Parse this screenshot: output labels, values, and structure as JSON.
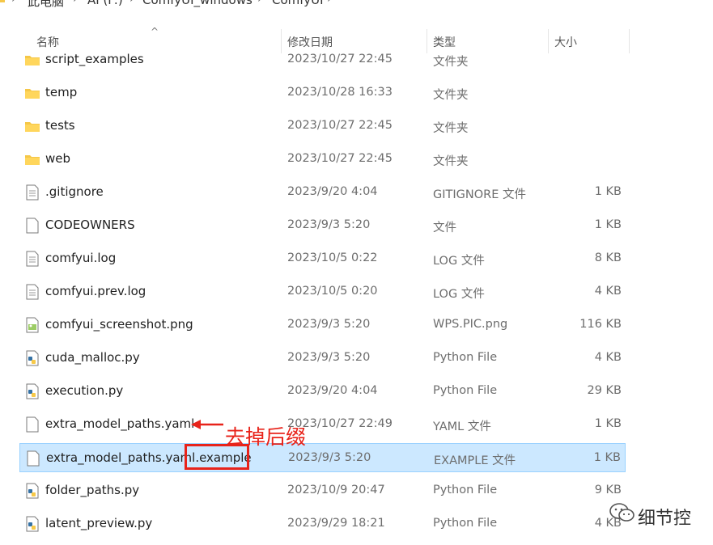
{
  "breadcrumb": [
    "此电脑",
    "AI (F:)",
    "ComfyUI_windows",
    "ComfyUI"
  ],
  "columns": {
    "name": "名称",
    "date": "修改日期",
    "type": "类型",
    "size": "大小"
  },
  "files": [
    {
      "name": "script_examples",
      "date": "2023/10/27 22:45",
      "type": "文件夹",
      "size": "",
      "icon": "folder-icon"
    },
    {
      "name": "temp",
      "date": "2023/10/28 16:33",
      "type": "文件夹",
      "size": "",
      "icon": "folder-icon"
    },
    {
      "name": "tests",
      "date": "2023/10/27 22:45",
      "type": "文件夹",
      "size": "",
      "icon": "folder-icon"
    },
    {
      "name": "web",
      "date": "2023/10/27 22:45",
      "type": "文件夹",
      "size": "",
      "icon": "folder-icon"
    },
    {
      "name": ".gitignore",
      "date": "2023/9/20 4:04",
      "type": "GITIGNORE 文件",
      "size": "1 KB",
      "icon": "text-file-icon"
    },
    {
      "name": "CODEOWNERS",
      "date": "2023/9/3 5:20",
      "type": "文件",
      "size": "1 KB",
      "icon": "blank-file-icon"
    },
    {
      "name": "comfyui.log",
      "date": "2023/10/5 0:22",
      "type": "LOG 文件",
      "size": "8 KB",
      "icon": "text-file-icon"
    },
    {
      "name": "comfyui.prev.log",
      "date": "2023/10/5 0:20",
      "type": "LOG 文件",
      "size": "4 KB",
      "icon": "text-file-icon"
    },
    {
      "name": "comfyui_screenshot.png",
      "date": "2023/9/3 5:20",
      "type": "WPS.PIC.png",
      "size": "116 KB",
      "icon": "image-file-icon"
    },
    {
      "name": "cuda_malloc.py",
      "date": "2023/9/3 5:20",
      "type": "Python File",
      "size": "4 KB",
      "icon": "python-file-icon"
    },
    {
      "name": "execution.py",
      "date": "2023/9/20 4:04",
      "type": "Python File",
      "size": "29 KB",
      "icon": "python-file-icon"
    },
    {
      "name": "extra_model_paths.yaml",
      "date": "2023/10/27 22:49",
      "type": "YAML 文件",
      "size": "1 KB",
      "icon": "blank-file-icon"
    },
    {
      "name": "extra_model_paths.yaml.example",
      "date": "2023/9/3 5:20",
      "type": "EXAMPLE 文件",
      "size": "1 KB",
      "icon": "blank-file-icon"
    },
    {
      "name": "folder_paths.py",
      "date": "2023/10/9 20:47",
      "type": "Python File",
      "size": "9 KB",
      "icon": "python-file-icon"
    },
    {
      "name": "latent_preview.py",
      "date": "2023/9/29 18:21",
      "type": "Python File",
      "size": "4 KB",
      "icon": "python-file-icon"
    }
  ],
  "annotation": {
    "text": "去掉后缀",
    "color": "#e8231a"
  },
  "watermark": {
    "text": "细节控"
  },
  "colors": {
    "selected_bg": "#cce8ff",
    "folder": "#f5c748"
  }
}
